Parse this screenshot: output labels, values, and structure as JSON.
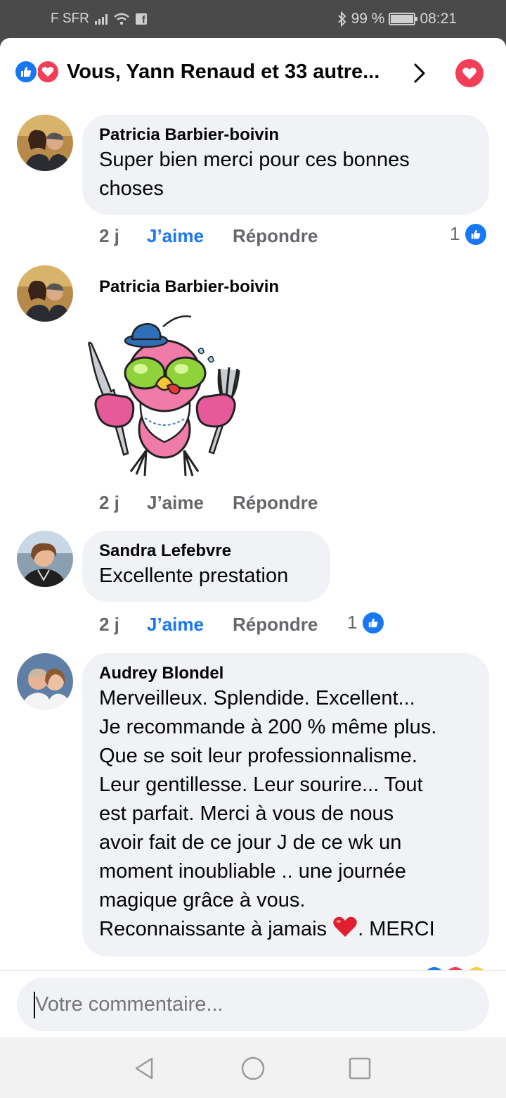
{
  "status_bar": {
    "carrier": "F SFR",
    "battery": "99 %",
    "time": "08:21"
  },
  "header": {
    "title": "Vous, Yann Renaud et 33 autre..."
  },
  "comments": [
    {
      "author": "Patricia Barbier-boivin",
      "text_lines": [
        "Super bien merci pour ces bonnes",
        "choses"
      ],
      "time": "2 j",
      "like_label": "J’aime",
      "reply_label": "Répondre",
      "reaction_count": "1"
    },
    {
      "author": "Patricia Barbier-boivin",
      "sticker": "hungry-bird-sticker",
      "time": "2 j",
      "like_label": "J’aime",
      "reply_label": "Répondre"
    },
    {
      "author": "Sandra Lefebvre",
      "text_lines": [
        "Excellente prestation"
      ],
      "time": "2 j",
      "like_label": "J’aime",
      "reply_label": "Répondre",
      "reaction_count": "1"
    },
    {
      "author": "Audrey Blondel",
      "text_lines": [
        "Merveilleux. Splendide. Excellent...",
        "Je recommande à 200 % même plus.",
        "Que se soit leur professionnalisme.",
        "Leur gentillesse. Leur sourire... Tout",
        "est parfait. Merci à vous de nous",
        "avoir fait de ce jour J de ce wk un",
        "moment inoubliable .. une journée",
        "magique grâce à vous."
      ],
      "last_line_before": "Reconnaissante à jamais ",
      "last_line_after": ". MERCI"
    }
  ],
  "composer": {
    "placeholder": "Votre commentaire..."
  },
  "colors": {
    "facebook_blue": "#1877f2",
    "love_red": "#f33e58",
    "bubble_bg": "#f0f2f5",
    "muted_text": "#65676b"
  }
}
